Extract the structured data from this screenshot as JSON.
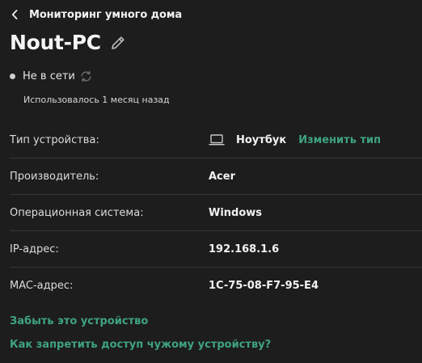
{
  "header": {
    "title": "Мониторинг умного дома",
    "back_icon": "chevron-left-icon"
  },
  "device": {
    "name": "Nout-PC",
    "edit_icon": "pencil-icon",
    "status": "Не в сети",
    "status_color": "#cfcfcf",
    "refresh_icon": "refresh-icon",
    "last_used": "Использовалось 1 месяц назад"
  },
  "properties": [
    {
      "label": "Тип устройства:",
      "value": "Ноутбук",
      "icon": "laptop-icon",
      "action": "Изменить тип"
    },
    {
      "label": "Производитель:",
      "value": "Acer"
    },
    {
      "label": "Операционная система:",
      "value": "Windows"
    },
    {
      "label": "IP-адрес:",
      "value": "192.168.1.6"
    },
    {
      "label": "MAC-адрес:",
      "value": "1C-75-08-F7-95-E4"
    }
  ],
  "links": {
    "forget": "Забыть это устройство",
    "block": "Как запретить доступ чужому устройству?"
  },
  "colors": {
    "background": "#1d1d1d",
    "accent": "#3fa283",
    "divider": "#363636"
  }
}
